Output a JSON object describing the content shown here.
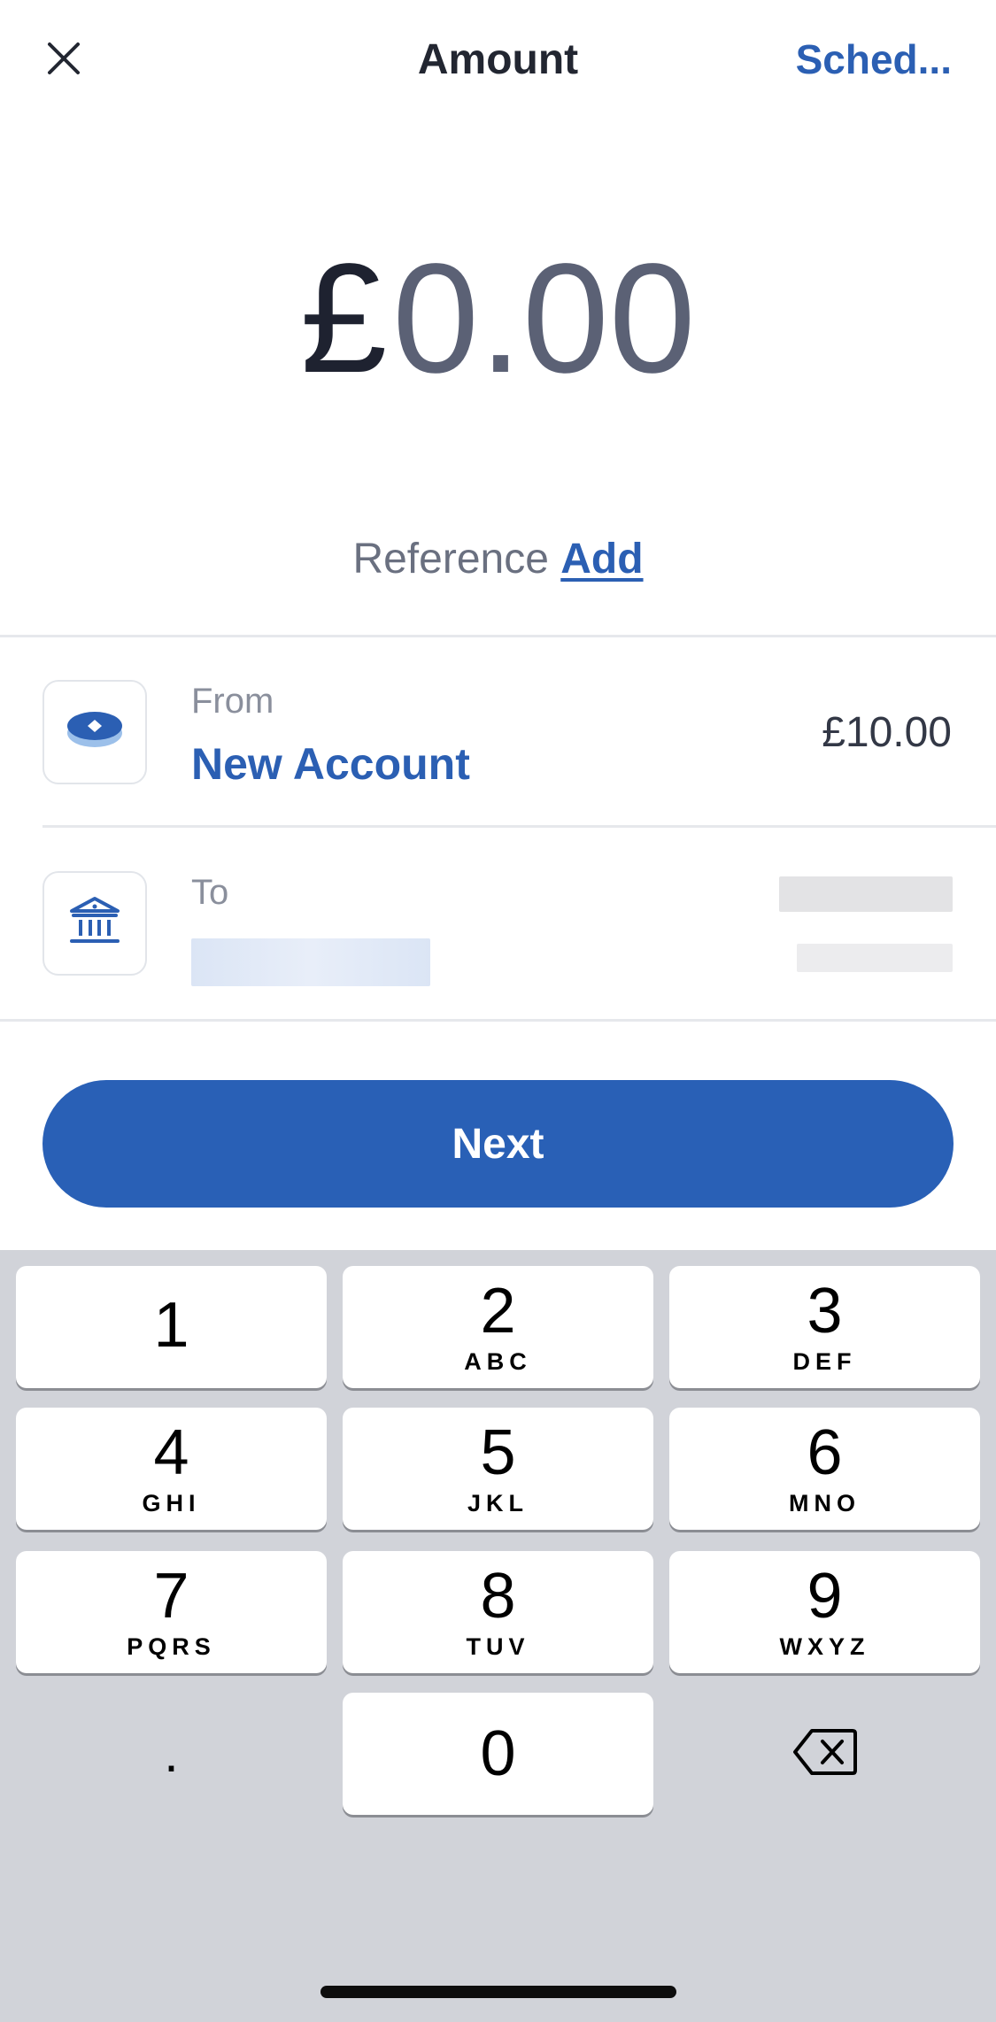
{
  "header": {
    "title": "Amount",
    "schedule_label": "Sched..."
  },
  "amount": {
    "currency": "£",
    "value": "0.00"
  },
  "reference": {
    "label": "Reference",
    "add_label": "Add"
  },
  "from": {
    "label": "From",
    "account_name": "New Account",
    "balance": "£10.00"
  },
  "to": {
    "label": "To"
  },
  "next_label": "Next",
  "keypad": {
    "keys": [
      {
        "digit": "1",
        "letters": ""
      },
      {
        "digit": "2",
        "letters": "ABC"
      },
      {
        "digit": "3",
        "letters": "DEF"
      },
      {
        "digit": "4",
        "letters": "GHI"
      },
      {
        "digit": "5",
        "letters": "JKL"
      },
      {
        "digit": "6",
        "letters": "MNO"
      },
      {
        "digit": "7",
        "letters": "PQRS"
      },
      {
        "digit": "8",
        "letters": "TUV"
      },
      {
        "digit": "9",
        "letters": "WXYZ"
      },
      {
        "digit": "0",
        "letters": ""
      }
    ],
    "decimal": "."
  },
  "colors": {
    "accent": "#2960b6",
    "link": "#2b5fb3",
    "keyboard_bg": "#d1d3d9"
  },
  "icons": {
    "close": "close-icon",
    "from_account": "coin-stack-icon",
    "to_account": "bank-icon",
    "backspace": "backspace-icon"
  }
}
